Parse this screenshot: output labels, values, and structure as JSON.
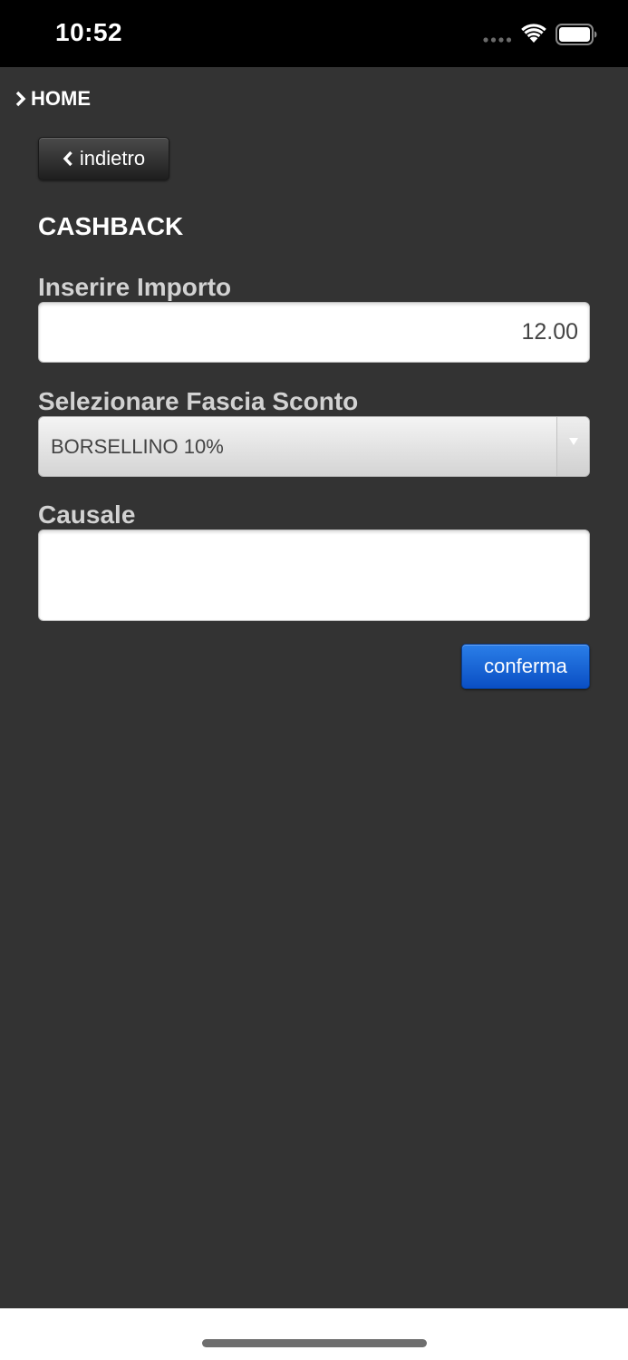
{
  "status_bar": {
    "time": "10:52"
  },
  "nav": {
    "home_label": "HOME",
    "back_label": "indietro"
  },
  "page": {
    "title": "CASHBACK"
  },
  "form": {
    "amount_label": "Inserire Importo",
    "amount_value": "12.00",
    "discount_label": "Selezionare Fascia Sconto",
    "discount_selected": "BORSELLINO 10%",
    "reason_label": "Causale",
    "reason_value": "",
    "confirm_label": "conferma"
  },
  "colors": {
    "background": "#333333",
    "status_bar": "#000000",
    "primary_button": "#0a5fd6"
  }
}
